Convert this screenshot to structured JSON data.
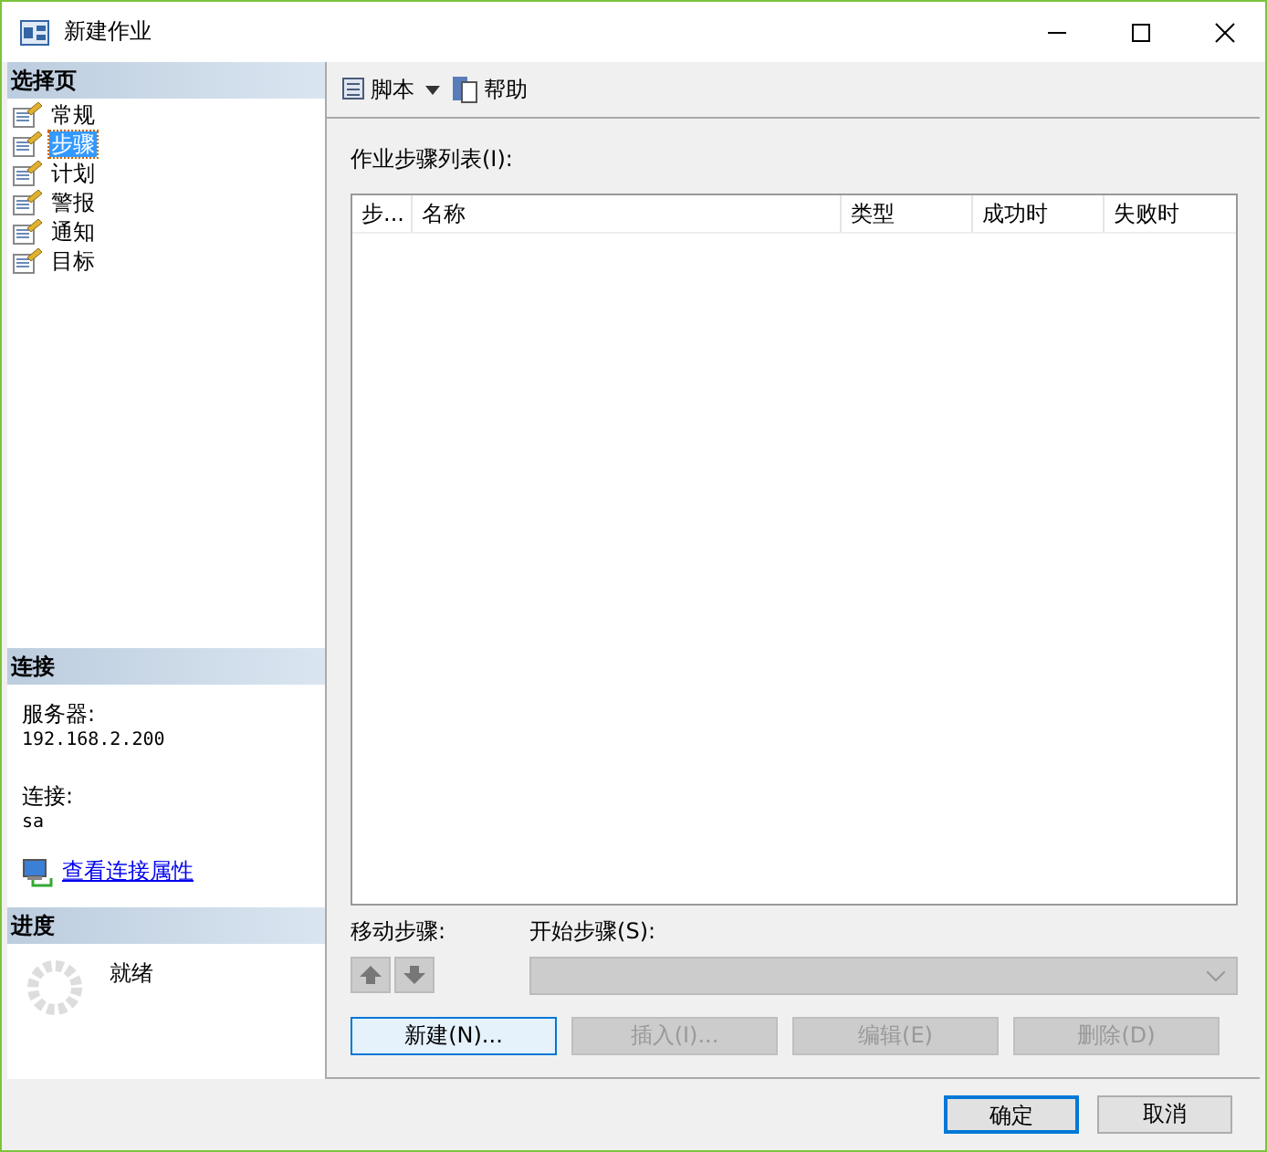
{
  "window": {
    "title": "新建作业"
  },
  "select_page": {
    "header": "选择页",
    "items": [
      {
        "label": "常规",
        "selected": false
      },
      {
        "label": "步骤",
        "selected": true
      },
      {
        "label": "计划",
        "selected": false
      },
      {
        "label": "警报",
        "selected": false
      },
      {
        "label": "通知",
        "selected": false
      },
      {
        "label": "目标",
        "selected": false
      }
    ]
  },
  "connection": {
    "header": "连接",
    "server_label": "服务器:",
    "server": "192.168.2.200",
    "login_label": "连接:",
    "login": "sa",
    "link": "查看连接属性"
  },
  "progress": {
    "header": "进度",
    "status": "就绪"
  },
  "toolbar": {
    "script": "脚本",
    "help": "帮助"
  },
  "steps_label": "作业步骤列表(I):",
  "table": {
    "columns": [
      "步...",
      "名称",
      "类型",
      "成功时",
      "失败时"
    ]
  },
  "move_label": "移动步骤:",
  "move_buttons": [
    {
      "kind": "up",
      "disabled": true
    },
    {
      "kind": "down",
      "disabled": true
    }
  ],
  "start_step": {
    "label": "开始步骤(S):",
    "disabled": true
  },
  "actions": [
    {
      "label": "新建(N)...",
      "disabled": false,
      "focused": true
    },
    {
      "label": "插入(I)...",
      "disabled": true,
      "focused": false
    },
    {
      "label": "编辑(E)",
      "disabled": true,
      "focused": false
    },
    {
      "label": "删除(D)",
      "disabled": true,
      "focused": false
    }
  ],
  "footer": [
    {
      "label": "确定",
      "default": true
    },
    {
      "label": "取消",
      "default": false
    }
  ]
}
